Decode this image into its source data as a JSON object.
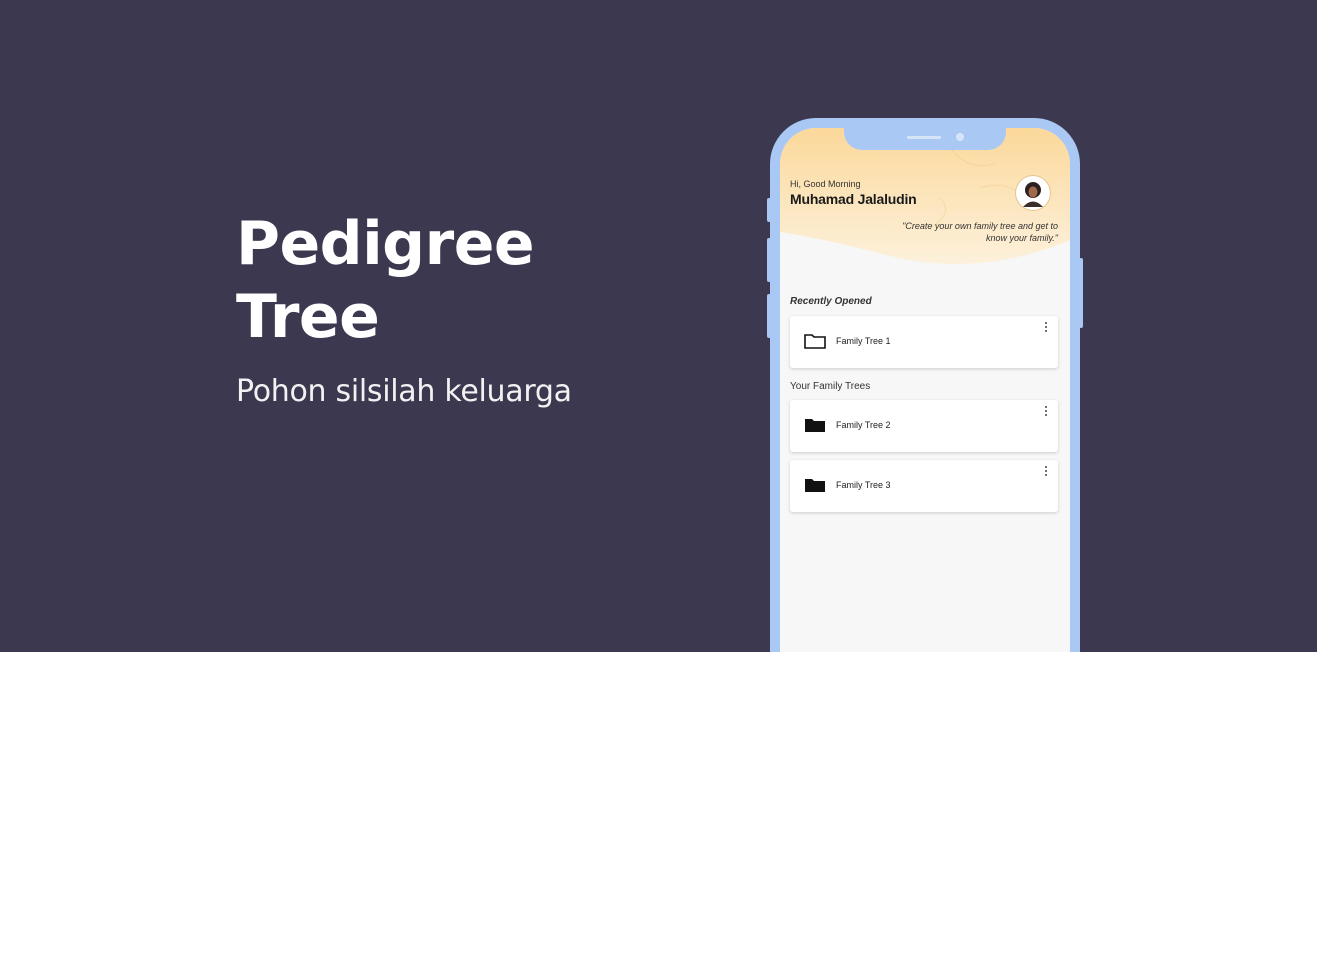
{
  "hero": {
    "title_line1": "Pedigree",
    "title_line2": "Tree",
    "subtitle": "Pohon silsilah keluarga"
  },
  "app": {
    "greeting": "Hi, Good Morning",
    "user_name": "Muhamad Jalaludin",
    "quote": "\"Create your own family tree and get to know your family.\"",
    "recent_label": "Recently Opened",
    "recent_items": [
      {
        "name": "Family Tree 1",
        "icon": "folder-outline-icon"
      }
    ],
    "trees_label": "Your Family Trees",
    "tree_items": [
      {
        "name": "Family Tree 2",
        "icon": "folder-filled-icon"
      },
      {
        "name": "Family Tree 3",
        "icon": "folder-filled-icon"
      }
    ]
  },
  "colors": {
    "banner_bg": "#3b3850",
    "phone_frame": "#a9c8f3",
    "header_gradient_top": "#fbd89a",
    "header_gradient_bottom": "#fdf1dc"
  }
}
